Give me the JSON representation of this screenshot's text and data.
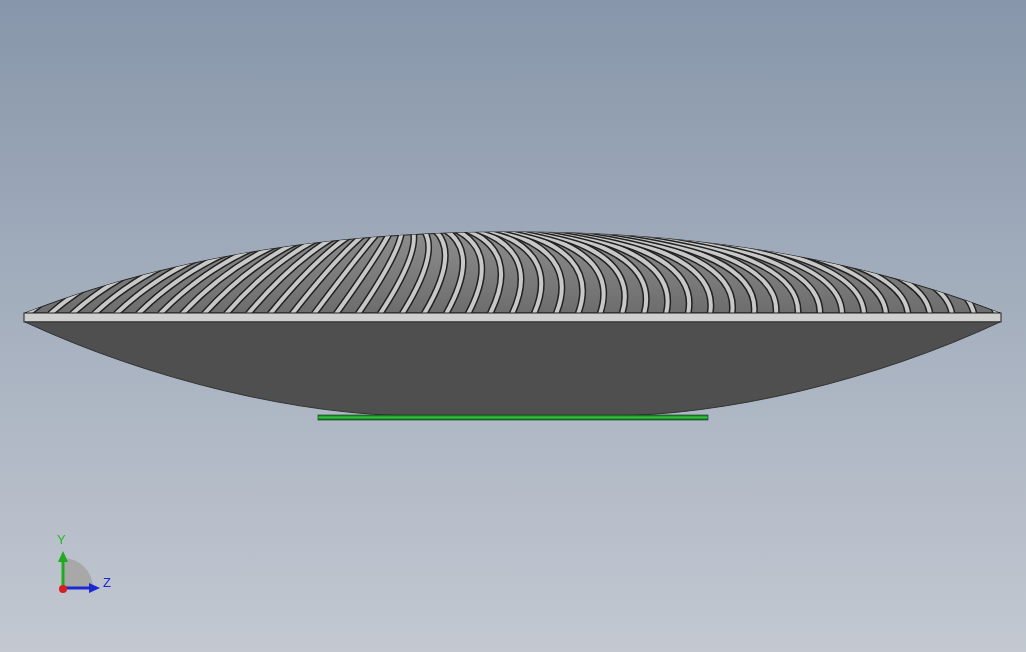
{
  "viewport": {
    "axes": [
      {
        "label": "Y",
        "kind": "vertical"
      },
      {
        "label": "Z",
        "kind": "horizontal"
      }
    ]
  }
}
